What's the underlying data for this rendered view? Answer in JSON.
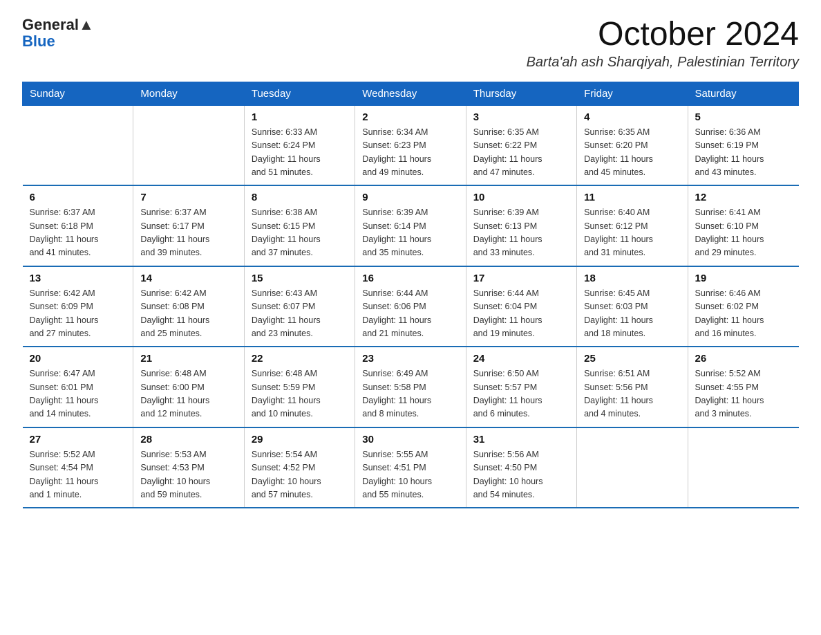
{
  "header": {
    "logo_line1": "General",
    "logo_line2": "Blue",
    "title": "October 2024",
    "subtitle": "Barta'ah ash Sharqiyah, Palestinian Territory"
  },
  "weekdays": [
    "Sunday",
    "Monday",
    "Tuesday",
    "Wednesday",
    "Thursday",
    "Friday",
    "Saturday"
  ],
  "weeks": [
    [
      {
        "day": "",
        "info": ""
      },
      {
        "day": "",
        "info": ""
      },
      {
        "day": "1",
        "info": "Sunrise: 6:33 AM\nSunset: 6:24 PM\nDaylight: 11 hours\nand 51 minutes."
      },
      {
        "day": "2",
        "info": "Sunrise: 6:34 AM\nSunset: 6:23 PM\nDaylight: 11 hours\nand 49 minutes."
      },
      {
        "day": "3",
        "info": "Sunrise: 6:35 AM\nSunset: 6:22 PM\nDaylight: 11 hours\nand 47 minutes."
      },
      {
        "day": "4",
        "info": "Sunrise: 6:35 AM\nSunset: 6:20 PM\nDaylight: 11 hours\nand 45 minutes."
      },
      {
        "day": "5",
        "info": "Sunrise: 6:36 AM\nSunset: 6:19 PM\nDaylight: 11 hours\nand 43 minutes."
      }
    ],
    [
      {
        "day": "6",
        "info": "Sunrise: 6:37 AM\nSunset: 6:18 PM\nDaylight: 11 hours\nand 41 minutes."
      },
      {
        "day": "7",
        "info": "Sunrise: 6:37 AM\nSunset: 6:17 PM\nDaylight: 11 hours\nand 39 minutes."
      },
      {
        "day": "8",
        "info": "Sunrise: 6:38 AM\nSunset: 6:15 PM\nDaylight: 11 hours\nand 37 minutes."
      },
      {
        "day": "9",
        "info": "Sunrise: 6:39 AM\nSunset: 6:14 PM\nDaylight: 11 hours\nand 35 minutes."
      },
      {
        "day": "10",
        "info": "Sunrise: 6:39 AM\nSunset: 6:13 PM\nDaylight: 11 hours\nand 33 minutes."
      },
      {
        "day": "11",
        "info": "Sunrise: 6:40 AM\nSunset: 6:12 PM\nDaylight: 11 hours\nand 31 minutes."
      },
      {
        "day": "12",
        "info": "Sunrise: 6:41 AM\nSunset: 6:10 PM\nDaylight: 11 hours\nand 29 minutes."
      }
    ],
    [
      {
        "day": "13",
        "info": "Sunrise: 6:42 AM\nSunset: 6:09 PM\nDaylight: 11 hours\nand 27 minutes."
      },
      {
        "day": "14",
        "info": "Sunrise: 6:42 AM\nSunset: 6:08 PM\nDaylight: 11 hours\nand 25 minutes."
      },
      {
        "day": "15",
        "info": "Sunrise: 6:43 AM\nSunset: 6:07 PM\nDaylight: 11 hours\nand 23 minutes."
      },
      {
        "day": "16",
        "info": "Sunrise: 6:44 AM\nSunset: 6:06 PM\nDaylight: 11 hours\nand 21 minutes."
      },
      {
        "day": "17",
        "info": "Sunrise: 6:44 AM\nSunset: 6:04 PM\nDaylight: 11 hours\nand 19 minutes."
      },
      {
        "day": "18",
        "info": "Sunrise: 6:45 AM\nSunset: 6:03 PM\nDaylight: 11 hours\nand 18 minutes."
      },
      {
        "day": "19",
        "info": "Sunrise: 6:46 AM\nSunset: 6:02 PM\nDaylight: 11 hours\nand 16 minutes."
      }
    ],
    [
      {
        "day": "20",
        "info": "Sunrise: 6:47 AM\nSunset: 6:01 PM\nDaylight: 11 hours\nand 14 minutes."
      },
      {
        "day": "21",
        "info": "Sunrise: 6:48 AM\nSunset: 6:00 PM\nDaylight: 11 hours\nand 12 minutes."
      },
      {
        "day": "22",
        "info": "Sunrise: 6:48 AM\nSunset: 5:59 PM\nDaylight: 11 hours\nand 10 minutes."
      },
      {
        "day": "23",
        "info": "Sunrise: 6:49 AM\nSunset: 5:58 PM\nDaylight: 11 hours\nand 8 minutes."
      },
      {
        "day": "24",
        "info": "Sunrise: 6:50 AM\nSunset: 5:57 PM\nDaylight: 11 hours\nand 6 minutes."
      },
      {
        "day": "25",
        "info": "Sunrise: 6:51 AM\nSunset: 5:56 PM\nDaylight: 11 hours\nand 4 minutes."
      },
      {
        "day": "26",
        "info": "Sunrise: 5:52 AM\nSunset: 4:55 PM\nDaylight: 11 hours\nand 3 minutes."
      }
    ],
    [
      {
        "day": "27",
        "info": "Sunrise: 5:52 AM\nSunset: 4:54 PM\nDaylight: 11 hours\nand 1 minute."
      },
      {
        "day": "28",
        "info": "Sunrise: 5:53 AM\nSunset: 4:53 PM\nDaylight: 10 hours\nand 59 minutes."
      },
      {
        "day": "29",
        "info": "Sunrise: 5:54 AM\nSunset: 4:52 PM\nDaylight: 10 hours\nand 57 minutes."
      },
      {
        "day": "30",
        "info": "Sunrise: 5:55 AM\nSunset: 4:51 PM\nDaylight: 10 hours\nand 55 minutes."
      },
      {
        "day": "31",
        "info": "Sunrise: 5:56 AM\nSunset: 4:50 PM\nDaylight: 10 hours\nand 54 minutes."
      },
      {
        "day": "",
        "info": ""
      },
      {
        "day": "",
        "info": ""
      }
    ]
  ]
}
